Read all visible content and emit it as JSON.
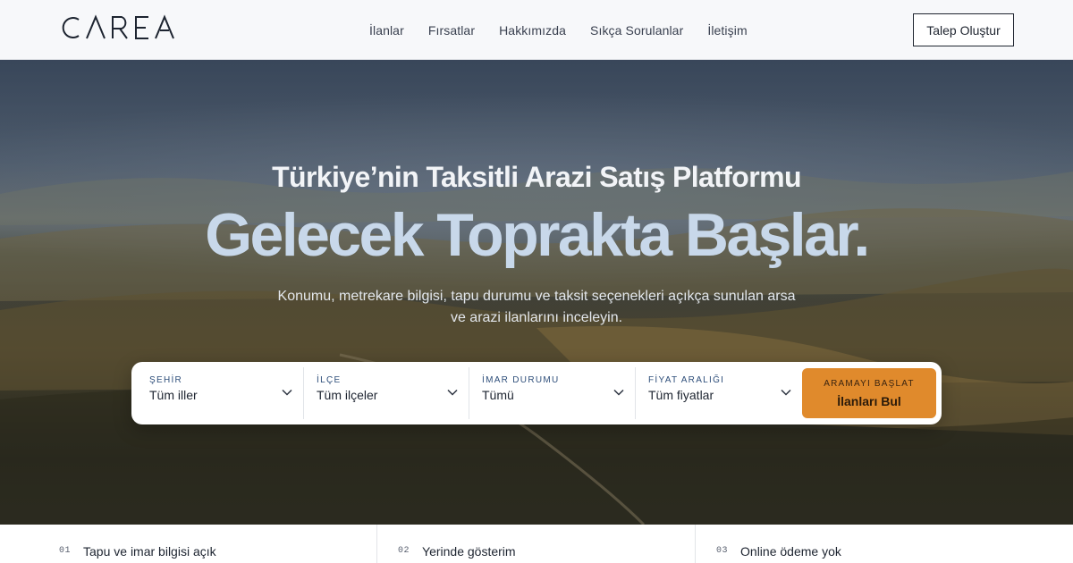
{
  "brand": {
    "logo_text": "CAREA"
  },
  "nav": {
    "items": [
      {
        "label": "İlanlar"
      },
      {
        "label": "Fırsatlar"
      },
      {
        "label": "Hakkımızda"
      },
      {
        "label": "Sıkça Sorulanlar"
      },
      {
        "label": "İletişim"
      }
    ],
    "cta_label": "Talep Oluştur"
  },
  "hero": {
    "subtitle": "Türkiye’nin Taksitli Arazi Satış Platformu",
    "title": "Gelecek Toprakta Başlar.",
    "description": "Konumu, metrekare bilgisi, tapu durumu ve taksit seçenekleri açıkça sunulan arsa ve arazi ilanlarını inceleyin."
  },
  "search": {
    "fields": [
      {
        "label": "ŞEHİR",
        "value": "Tüm iller",
        "icon": "chevron-down-icon"
      },
      {
        "label": "İLÇE",
        "value": "Tüm ilçeler",
        "icon": "chevron-down-icon"
      },
      {
        "label": "İMAR DURUMU",
        "value": "Tümü",
        "icon": "chevron-down-icon"
      },
      {
        "label": "FİYAT ARALIĞI",
        "value": "Tüm fiyatlar",
        "icon": "chevron-down-icon"
      }
    ],
    "button_kicker": "ARAMAYI BAŞLAT",
    "button_label": "İlanları Bul"
  },
  "features": [
    {
      "number": "01",
      "text": "Tapu ve imar bilgisi açık"
    },
    {
      "number": "02",
      "text": "Yerinde gösterim"
    },
    {
      "number": "03",
      "text": "Online ödeme yok"
    }
  ],
  "colors": {
    "accent": "#e08a2c",
    "title": "#c8d8ea",
    "label": "#2e4e7a",
    "header_bg": "#f7f8fa"
  }
}
